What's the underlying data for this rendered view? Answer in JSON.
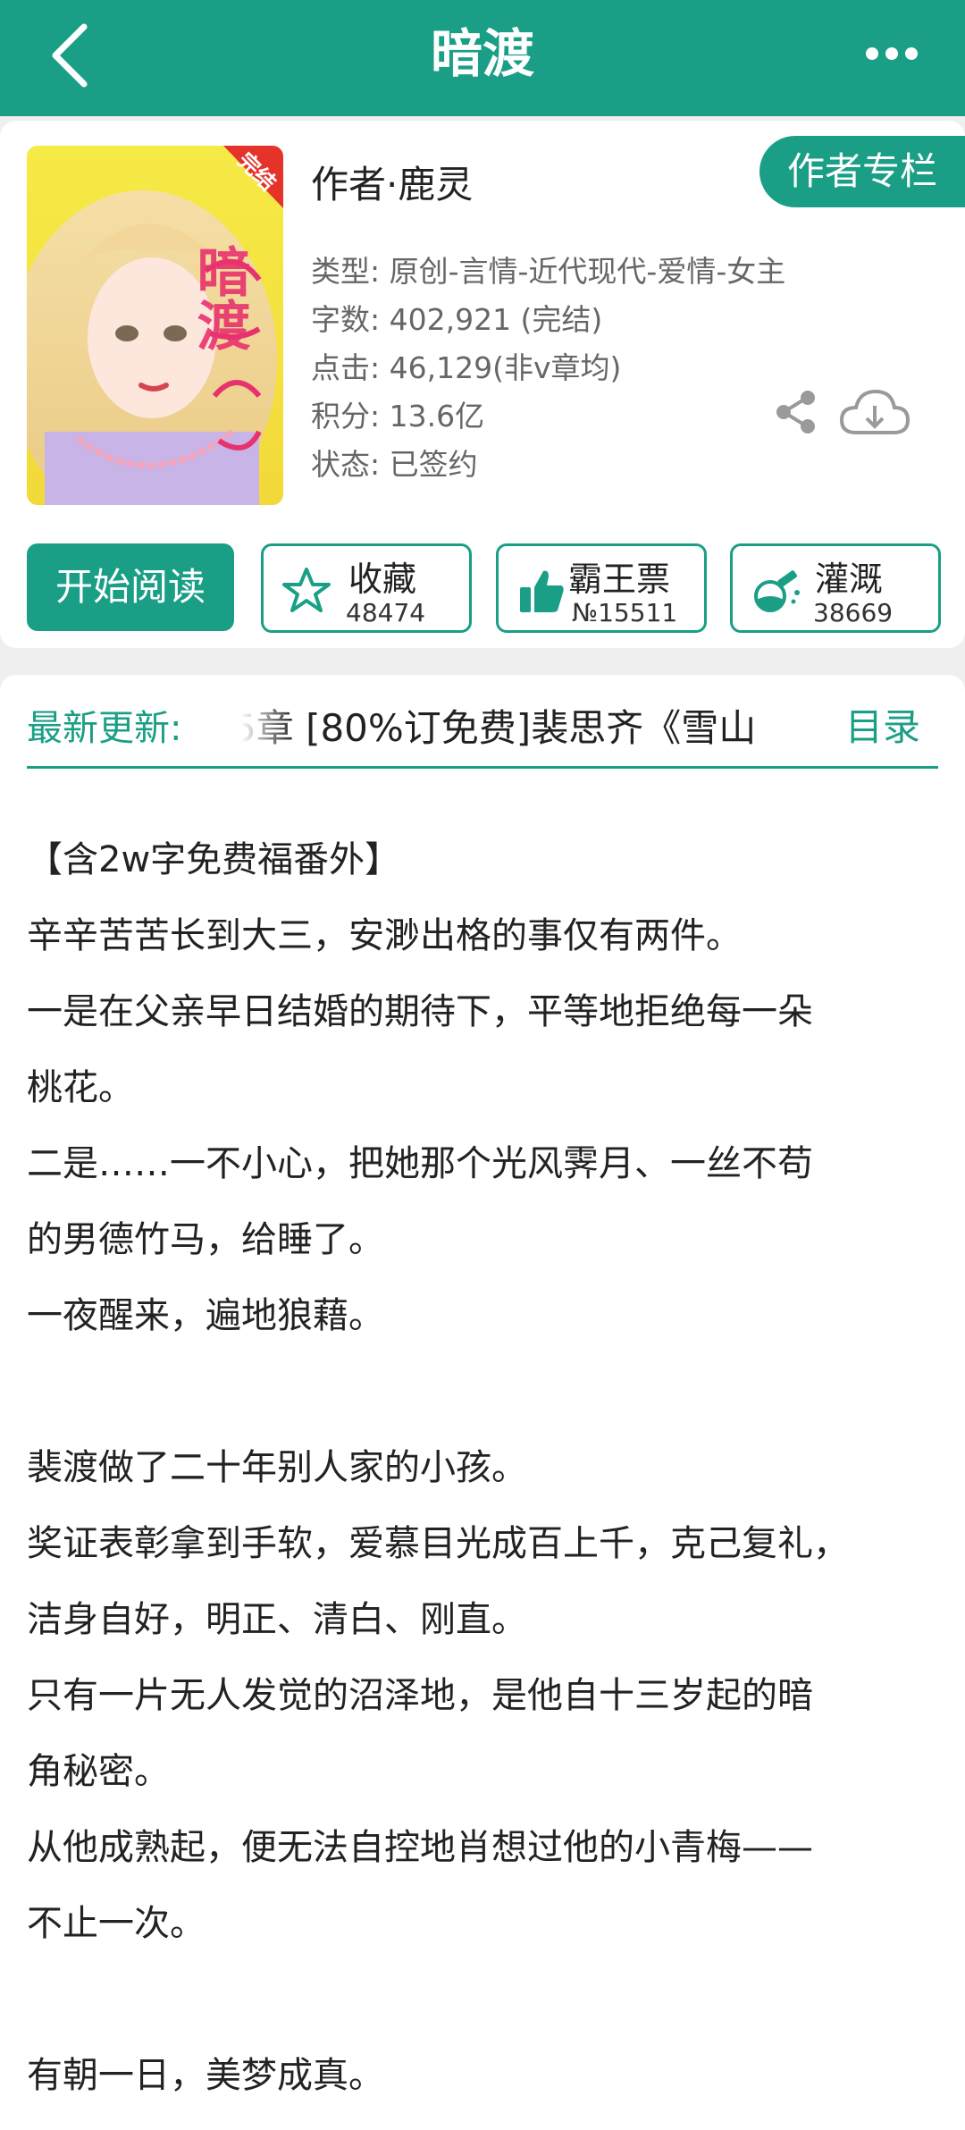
{
  "header": {
    "title": "暗渡",
    "back_icon": "chevron-left-icon",
    "more_icon": "more-dots-icon"
  },
  "cover": {
    "badge": "完结",
    "title_art": "暗渡"
  },
  "book": {
    "author": "作者·鹿灵",
    "author_column_label": "作者专栏",
    "meta": [
      "类型: 原创-言情-近代现代-爱情-女主",
      "字数: 402,921 (完结)",
      "点击: 46,129(非v章均)",
      "积分: 13.6亿",
      "状态: 已签约"
    ]
  },
  "actions": {
    "read_label": "开始阅读",
    "collect": {
      "label": "收藏",
      "count": "48474",
      "icon": "star-icon"
    },
    "vote": {
      "label": "霸王票",
      "count": "№15511",
      "icon": "thumbs-up-icon"
    },
    "water": {
      "label": "灌溉",
      "count": "38669",
      "icon": "nutrient-bottle-icon"
    }
  },
  "latest": {
    "label": "最新更新:",
    "text": "5章  [80%订免费]裴思齐《雪山",
    "toc_label": "目录"
  },
  "synopsis": [
    "【含2w字免费福番外】",
    "辛辛苦苦长到大三，安渺出格的事仅有两件。",
    "一是在父亲早日结婚的期待下，平等地拒绝每一朵",
    "桃花。",
    "二是……一不小心，把她那个光风霁月、一丝不苟",
    "的男德竹马，给睡了。",
    "一夜醒来，遍地狼藉。",
    "",
    "裴渡做了二十年别人家的小孩。",
    "奖证表彰拿到手软，爱慕目光成百上千，克己复礼，",
    "洁身自好，明正、清白、刚直。",
    "只有一片无人发觉的沼泽地，是他自十三岁起的暗",
    "角秘密。",
    "从他成熟起，便无法自控地肖想过他的小青梅——",
    "不止一次。",
    "",
    "有朝一日，美梦成真。"
  ],
  "colors": {
    "accent": "#1a9f86",
    "background": "#efefef"
  }
}
